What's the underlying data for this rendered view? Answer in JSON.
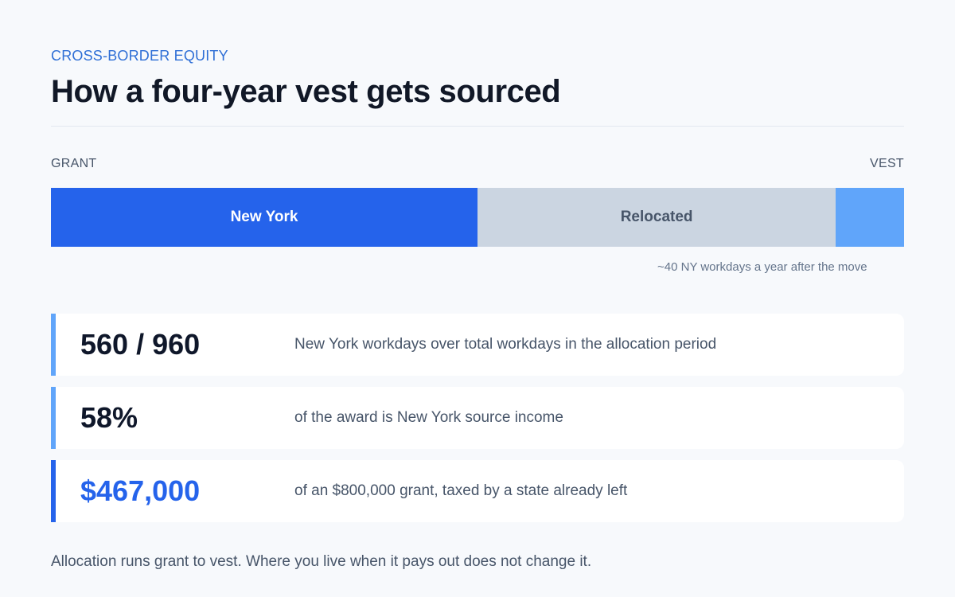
{
  "header": {
    "eyebrow": "CROSS-BORDER EQUITY",
    "title": "How a four-year vest gets sourced"
  },
  "timeline": {
    "start_label": "GRANT",
    "end_label": "VEST",
    "segments": [
      {
        "label": "New York",
        "share": 0.5,
        "color": "#2563eb"
      },
      {
        "label": "Relocated",
        "share": 0.42,
        "color": "#cbd5e1"
      },
      {
        "label": "",
        "share": 0.08,
        "color": "#60a5fa"
      }
    ],
    "note": "~40 NY workdays a year after the move"
  },
  "stats": [
    {
      "value": "560 / 960",
      "description": "New York workdays over total workdays in the allocation period",
      "accent": "#60a5fa"
    },
    {
      "value": "58%",
      "description": "of the award is New York source income",
      "accent": "#60a5fa"
    },
    {
      "value": "$467,000",
      "description": "of an $800,000 grant, taxed by a state already left",
      "accent": "#2563eb"
    }
  ],
  "footer": {
    "text": "Allocation runs grant to vest. Where you live when it pays out does not change it."
  }
}
